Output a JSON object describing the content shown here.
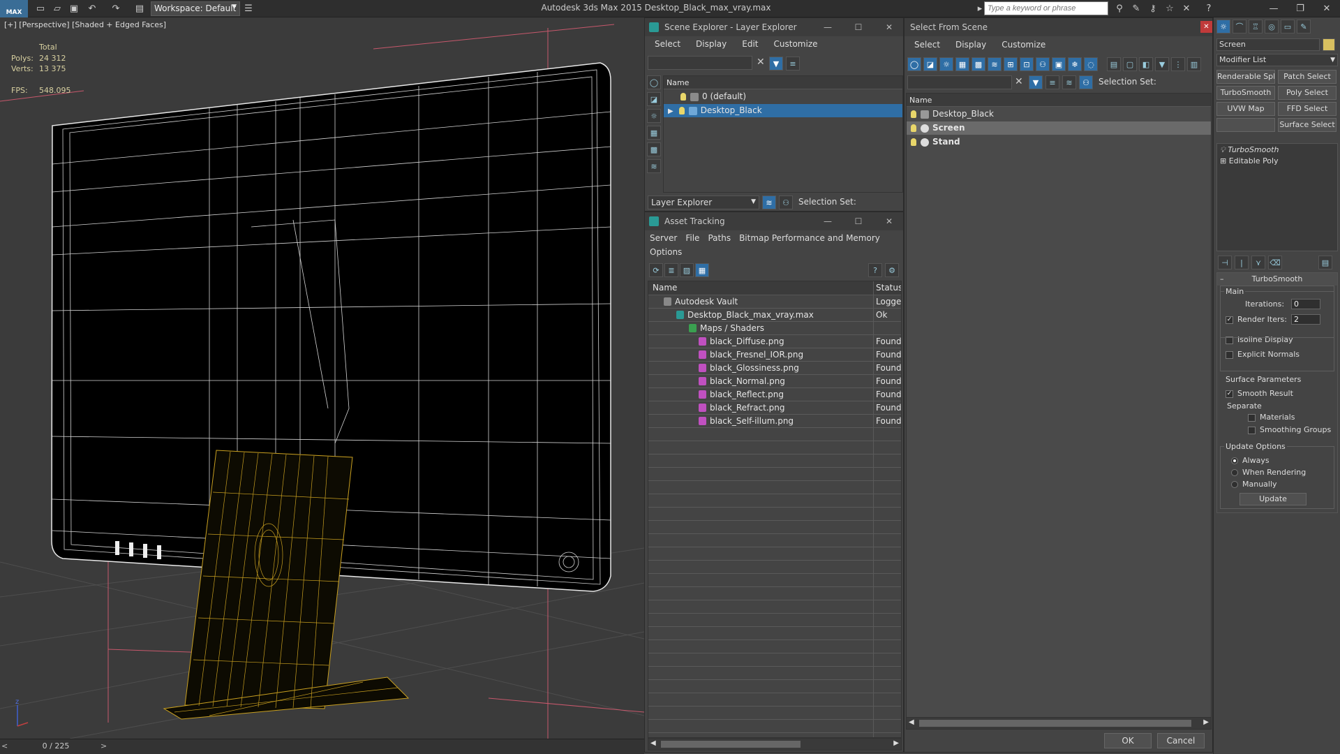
{
  "app": {
    "logo": "MAX",
    "title": "Autodesk 3ds Max  2015    Desktop_Black_max_vray.max",
    "workspace": "Workspace: Default",
    "search_placeholder": "Type a keyword or phrase"
  },
  "viewport": {
    "label": "[+] [Perspective] [Shaded + Edged Faces]",
    "stats": {
      "total_label": "Total",
      "polys_label": "Polys:",
      "polys": "24 312",
      "verts_label": "Verts:",
      "verts": "13 375",
      "fps_label": "FPS:",
      "fps": "548.095"
    },
    "frame_counter": "0 / 225"
  },
  "scene_explorer": {
    "title": "Scene Explorer - Layer Explorer",
    "menu": [
      "Select",
      "Display",
      "Edit",
      "Customize"
    ],
    "column": "Name",
    "layers": [
      {
        "name": "0 (default)",
        "selected": false
      },
      {
        "name": "Desktop_Black",
        "selected": true
      }
    ],
    "footer_dropdown": "Layer Explorer",
    "selection_set_label": "Selection Set:"
  },
  "asset_tracking": {
    "title": "Asset Tracking",
    "menu": [
      "Server",
      "File",
      "Paths",
      "Bitmap Performance and Memory"
    ],
    "menu2": [
      "Options"
    ],
    "columns": [
      "Name",
      "Status"
    ],
    "rows": [
      {
        "name": "Autodesk Vault",
        "status": "Logged",
        "indent": 0
      },
      {
        "name": "Desktop_Black_max_vray.max",
        "status": "Ok",
        "indent": 1
      },
      {
        "name": "Maps / Shaders",
        "status": "",
        "indent": 2
      },
      {
        "name": "black_Diffuse.png",
        "status": "Found",
        "indent": 3
      },
      {
        "name": "black_Fresnel_IOR.png",
        "status": "Found",
        "indent": 3
      },
      {
        "name": "black_Glossiness.png",
        "status": "Found",
        "indent": 3
      },
      {
        "name": "black_Normal.png",
        "status": "Found",
        "indent": 3
      },
      {
        "name": "black_Reflect.png",
        "status": "Found",
        "indent": 3
      },
      {
        "name": "black_Refract.png",
        "status": "Found",
        "indent": 3
      },
      {
        "name": "black_Self-illum.png",
        "status": "Found",
        "indent": 3
      }
    ]
  },
  "select_from_scene": {
    "title": "Select From Scene",
    "menu": [
      "Select",
      "Display",
      "Customize"
    ],
    "selection_set_label": "Selection Set:",
    "column": "Name",
    "items": [
      {
        "name": "Desktop_Black",
        "bold": false,
        "selected": false
      },
      {
        "name": "Screen",
        "bold": true,
        "selected": true
      },
      {
        "name": "Stand",
        "bold": true,
        "selected": false
      }
    ],
    "ok": "OK",
    "cancel": "Cancel"
  },
  "command_panel": {
    "object_name": "Screen",
    "modifier_list": "Modifier List",
    "buttons": [
      "Renderable Spline",
      "Patch Select",
      "TurboSmooth",
      "Poly Select",
      "UVW Map",
      "FFD Select",
      "",
      "Surface Select"
    ],
    "stack": [
      "TurboSmooth",
      "Editable Poly"
    ],
    "rollout_title": "TurboSmooth",
    "main_label": "Main",
    "iterations_label": "Iterations:",
    "iterations": "0",
    "render_iters_label": "Render Iters:",
    "render_iters": "2",
    "isoline": "Isoline Display",
    "explicit_normals": "Explicit Normals",
    "surface_params": "Surface Parameters",
    "smooth_result": "Smooth Result",
    "separate": "Separate",
    "materials": "Materials",
    "smoothing_groups": "Smoothing Groups",
    "update_options": "Update Options",
    "always": "Always",
    "when_rendering": "When Rendering",
    "manually": "Manually",
    "update_btn": "Update"
  },
  "colors": {
    "selection_blue": "#2f6ea5",
    "wire_white": "#e8e8e8",
    "wire_yellow": "#c9a020",
    "bg_panel": "#444444"
  }
}
